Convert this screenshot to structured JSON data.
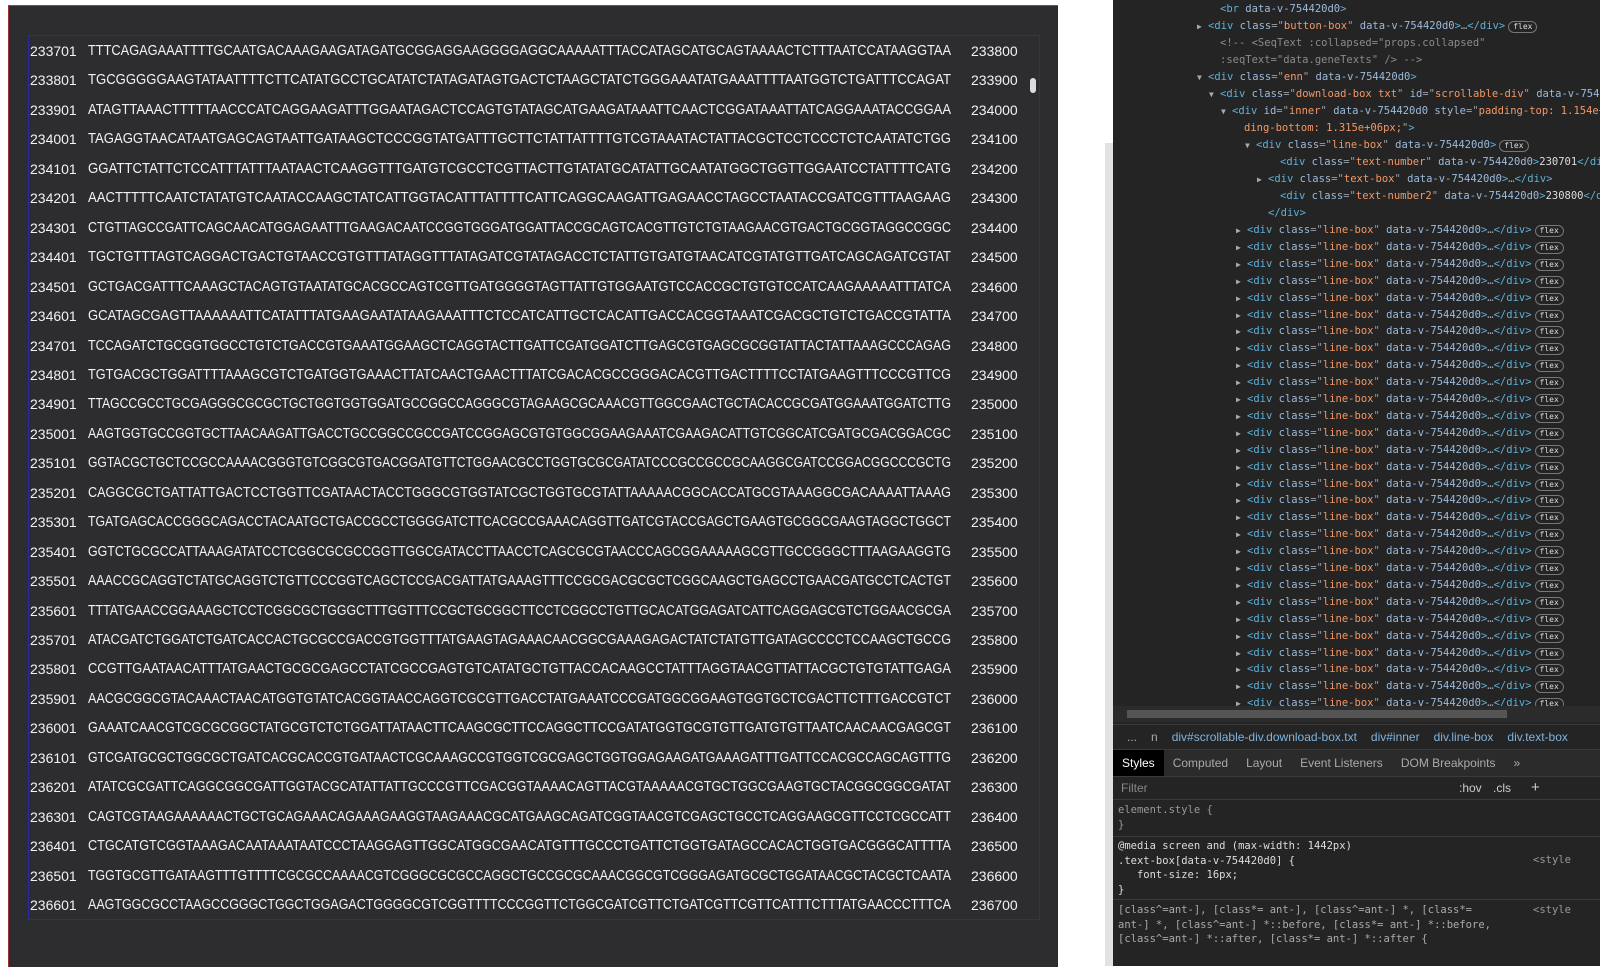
{
  "sequence_lines": [
    {
      "start": "233701",
      "seq": "TTTCAGAGAAATTTTGCAATGACAAAGAAGATAGATGCGGAGGAAGGGGAGGCAAAAATTTACCATAGCATGCAGTAAAACTCTTTAATCCATAAGGTAA",
      "end": "233800"
    },
    {
      "start": "233801",
      "seq": "TGCGGGGGAAGTATAATTTTCTTCATATGCCTGCATATCTATAGATAGTGACTCTAAGCTATCTGGGAAATATGAAATTTTAATGGTCTGATTTCCAGAT",
      "end": "233900"
    },
    {
      "start": "233901",
      "seq": "ATAGTTAAACTTTTTAACCCATCAGGAAGATTTGGAATAGACTCCAGTGTATAGCATGAAGATAAATTCAACTCGGATAAATTATCAGGAAATACCGGAA",
      "end": "234000"
    },
    {
      "start": "234001",
      "seq": "TAGAGGTAACATAATGAGCAGTAATTGATAAGCTCCCGGTATGATTTGCTTCTATTATTTTGTCGTAAATACTATTACGCTCCTCCCTCTCAATATCTGG",
      "end": "234100"
    },
    {
      "start": "234101",
      "seq": "GGATTCTATTCTCCATTTATTTAATAACTCAAGGTTTGATGTCGCCTCGTTACTTGTATATGCATATTGCAATATGGCTGGTTGGAATCCTATTTTCATG",
      "end": "234200"
    },
    {
      "start": "234201",
      "seq": "AACTTTTTCAATCTATATGTCAATACCAAGCTATCATTGGTACATTTATTTTCATTCAGGCAAGATTGAGAACCTAGCCTAATACCGATCGTTTAAGAAG",
      "end": "234300"
    },
    {
      "start": "234301",
      "seq": "CTGTTAGCCGATTCAGCAACATGGAGAATTTGAAGACAATCCGGTGGGATGGATTACCGCAGTCACGTTGTCTGTAAGAACGTGACTGCGGTAGGCCGGC",
      "end": "234400"
    },
    {
      "start": "234401",
      "seq": "TGCTGTTTAGTCAGGACTGACTGTAACCGTGTTTATAGGTTTATAGATCGTATAGACCTCTATTGTGATGTAACATCGTATGTTGATCAGCAGATCGTAT",
      "end": "234500"
    },
    {
      "start": "234501",
      "seq": "GCTGACGATTTCAAAGCTACAGTGTAATATGCACGCCAGTCGTTGATGGGGTAGTTATTGTGGAATGTCCACCGCTGTGTCCATCAAGAAAAATTTATCA",
      "end": "234600"
    },
    {
      "start": "234601",
      "seq": "GCATAGCGAGTTAAAAAATTCATATTTATGAAGAATATAAGAAATTTCTCCATCATTGCTCACATTGACCACGGTAAATCGACGCTGTCTGACCGTATTA",
      "end": "234700"
    },
    {
      "start": "234701",
      "seq": "TCCAGATCTGCGGTGGCCTGTCTGACCGTGAAATGGAAGCTCAGGTACTTGATTCGATGGATCTTGAGCGTGAGCGCGGTATTACTATTAAAGCCCAGAG",
      "end": "234800"
    },
    {
      "start": "234801",
      "seq": "TGTGACGCTGGATTTTAAAGCGTCTGATGGTGAAACTTATCAACTGAACTTTATCGACACGCCGGGACACGTTGACTTTTCCTATGAAGTTTCCCGTTCG",
      "end": "234900"
    },
    {
      "start": "234901",
      "seq": "TTAGCCGCCTGCGAGGGCGCGCTGCTGGTGGTGGATGCCGGCCAGGGCGTAGAAGCGCAAACGTTGGCGAACTGCTACACCGCGATGGAAATGGATCTTG",
      "end": "235000"
    },
    {
      "start": "235001",
      "seq": "AAGTGGTGCCGGTGCTTAACAAGATTGACCTGCCGGCCGCCGATCCGGAGCGTGTGGCGGAAGAAATCGAAGACATTGTCGGCATCGATGCGACGGACGC",
      "end": "235100"
    },
    {
      "start": "235101",
      "seq": "GGTACGCTGCTCCGCCAAAACGGGTGTCGGCGTGACGGATGTTCTGGAACGCCTGGTGCGCGATATCCCGCCGCCGCAAGGCGATCCGGACGGCCCGCTG",
      "end": "235200"
    },
    {
      "start": "235201",
      "seq": "CAGGCGCTGATTATTGACTCCTGGTTCGATAACTACCTGGGCGTGGTATCGCTGGTGCGTATTAAAAACGGCACCATGCGTAAAGGCGACAAAATTAAAG",
      "end": "235300"
    },
    {
      "start": "235301",
      "seq": "TGATGAGCACCGGGCAGACCTACAATGCTGACCGCCTGGGGATCTTCACGCCGAAACAGGTTGATCGTACCGAGCTGAAGTGCGGCGAAGTAGGCTGGCT",
      "end": "235400"
    },
    {
      "start": "235401",
      "seq": "GGTCTGCGCCATTAAAGATATCCTCGGCGCGCCGGTTGGCGATACCTTAACCTCAGCGCGTAACCCAGCGGAAAAAGCGTTGCCGGGCTTTAAGAAGGTG",
      "end": "235500"
    },
    {
      "start": "235501",
      "seq": "AAACCGCAGGTCTATGCAGGTCTGTTCCCGGTCAGCTCCGACGATTATGAAAGTTTCCGCGACGCGCTCGGCAAGCTGAGCCTGAACGATGCCTCACTGT",
      "end": "235600"
    },
    {
      "start": "235601",
      "seq": "TTTATGAACCGGAAAGCTCCTCGGCGCTGGGCTTTGGTTTCCGCTGCGGCTTCCTCGGCCTGTTGCACATGGAGATCATTCAGGAGCGTCTGGAACGCGA",
      "end": "235700"
    },
    {
      "start": "235701",
      "seq": "ATACGATCTGGATCTGATCACCACTGCGCCGACCGTGGTTTATGAAGTAGAAACAACGGCGAAAGAGACTATCTATGTTGATAGCCCCTCCAAGCTGCCG",
      "end": "235800"
    },
    {
      "start": "235801",
      "seq": "CCGTTGAATAACATTTATGAACTGCGCGAGCCTATCGCCGAGTGTCATATGCTGTTACCACAAGCCTATTTAGGTAACGTTATTACGCTGTGTATTGAGA",
      "end": "235900"
    },
    {
      "start": "235901",
      "seq": "AACGCGGCGTACAAACTAACATGGTGTATCACGGTAACCAGGTCGCGTTGACCTATGAAATCCCGATGGCGGAAGTGGTGCTCGACTTCTTTGACCGTCT",
      "end": "236000"
    },
    {
      "start": "236001",
      "seq": "GAAATCAACGTCGCGCGGCTATGCGTCTCTGGATTATAACTTCAAGCGCTTCCAGGCTTCCGATATGGTGCGTGTTGATGTGTTAATCAACAACGAGCGT",
      "end": "236100"
    },
    {
      "start": "236101",
      "seq": "GTCGATGCGCTGGCGCTGATCACGCACCGTGATAACTCGCAAAGCCGTGGTCGCGAGCTGGTGGAGAAGATGAAAGATTTGATTCCACGCCAGCAGTTTG",
      "end": "236200"
    },
    {
      "start": "236201",
      "seq": "ATATCGCGATTCAGGCGGCGATTGGTACGCATATTATTGCCCGTTCGACGGTAAAACAGTTACGTAAAAACGTGCTGGCGAAGTGCTACGGCGGCGATAT",
      "end": "236300"
    },
    {
      "start": "236301",
      "seq": "CAGTCGTAAGAAAAAACTGCTGCAGAAACAGAAAGAAGGTAAGAAACGCATGAAGCAGATCGGTAACGTCGAGCTGCCTCAGGAAGCGTTCCTCGCCATT",
      "end": "236400"
    },
    {
      "start": "236401",
      "seq": "CTGCATGTCGGTAAAGACAATAAATAATCCCTAAGGAGTTGGCATGGCGAACATGTTTGCCCTGATTCTGGTGATAGCCACACTGGTGACGGGCATTTTA",
      "end": "236500"
    },
    {
      "start": "236501",
      "seq": "TGGTGCGTTGATAAGTTTGTTTTCGCGCCAAAACGTCGGGCGCGCCAGGCTGCCGCGCAAACGGCGTCGGGAGATGCGCTGGATAACGCTACGCTCAATA",
      "end": "236600"
    },
    {
      "start": "236601",
      "seq": "AAGTGGCGCCTAAGCCGGGCTGGCTGGAGACTGGGGCGTCGGTTTTCCCGGTTCTGGCGATCGTTCTGATCGTTCGTTCATTTCTTTATGAACCCTTTCA",
      "end": "236700"
    }
  ],
  "devtools": {
    "elements": [
      {
        "indent": 6,
        "tri": "",
        "html": "<span class='tag'>&lt;br</span> <span class='attr'>data-v-754420d0</span><span class='tag'>&gt;</span>"
      },
      {
        "indent": 5,
        "tri": "▶",
        "html": "<span class='tag'>&lt;div</span> <span class='attr'>class</span>=\"<span class='val'>button-box</span>\" <span class='attr'>data-v-754420d0</span><span class='tag'>&gt;</span>…<span class='tag'>&lt;/div&gt;</span><span class='badge'>flex</span>"
      },
      {
        "indent": 6,
        "tri": "",
        "html": "<span class='cm'>&lt;!-- &lt;SeqText :collapsed=\"props.collapsed\"</span>"
      },
      {
        "indent": 6,
        "tri": "",
        "html": "<span class='cm'>:seqText=\"data.geneTexts\" /&gt; --&gt;</span>"
      },
      {
        "indent": 5,
        "tri": "▼",
        "html": "<span class='tag'>&lt;div</span> <span class='attr'>class</span>=\"<span class='val'>enn</span>\" <span class='attr'>data-v-754420d0</span><span class='tag'>&gt;</span>"
      },
      {
        "indent": 6,
        "tri": "▼",
        "html": "<span class='tag'>&lt;div</span> <span class='attr'>class</span>=\"<span class='val'>download-box txt</span>\" <span class='attr'>id</span>=\"<span class='val'>scrollable-div</span>\" <span class='attr'>data-v-754420d0</span>"
      },
      {
        "indent": 7,
        "tri": "▼",
        "html": "<span class='tag'>&lt;div</span> <span class='attr'>id</span>=\"<span class='val'>inner</span>\" <span class='attr'>data-v-754420d0</span> <span class='attr'>style</span>=\"<span class='val'>padding-top: 1.154e+06px; pad</span>"
      },
      {
        "indent": 8,
        "tri": "",
        "html": "<span class='val'>ding-bottom: 1.315e+06px;</span>\"<span class='tag'>&gt;</span>"
      },
      {
        "indent": 9,
        "tri": "▼",
        "html": "<span class='tag'>&lt;div</span> <span class='attr'>class</span>=\"<span class='val'>line-box</span>\" <span class='attr'>data-v-754420d0</span><span class='tag'>&gt;</span><span class='badge'>flex</span>"
      },
      {
        "indent": 11,
        "tri": "",
        "html": "<span class='tag'>&lt;div</span> <span class='attr'>class</span>=\"<span class='val'>text-number</span>\" <span class='attr'>data-v-754420d0</span><span class='tag'>&gt;</span><span style='color:#ddd'>230701</span><span class='tag'>&lt;/div&gt;</span>"
      },
      {
        "indent": 10,
        "tri": "▶",
        "html": "<span class='tag'>&lt;div</span> <span class='attr'>class</span>=\"<span class='val'>text-box</span>\" <span class='attr'>data-v-754420d0</span><span class='tag'>&gt;</span>…<span class='tag'>&lt;/div&gt;</span>"
      },
      {
        "indent": 11,
        "tri": "",
        "html": "<span class='tag'>&lt;div</span> <span class='attr'>class</span>=\"<span class='val'>text-number2</span>\" <span class='attr'>data-v-754420d0</span><span class='tag'>&gt;</span><span style='color:#ddd'>230800</span><span class='tag'>&lt;/div&gt;</span>"
      },
      {
        "indent": 10,
        "tri": "",
        "html": "<span class='tag'>&lt;/div&gt;</span>"
      }
    ],
    "collapsed_line_box": "<span class='tag'>&lt;div</span> <span class='attr'>class</span>=\"<span class='val'>line-box</span>\" <span class='attr'>data-v-754420d0</span><span class='tag'>&gt;</span>…<span class='tag'>&lt;/div&gt;</span><span class='badge'>flex</span>",
    "collapsed_line_box_count": 29,
    "breadcrumbs": [
      "...",
      "n",
      "div#scrollable-div.download-box.txt",
      "div#inner",
      "div.line-box",
      "div.text-box"
    ],
    "tabs": [
      "Styles",
      "Computed",
      "Layout",
      "Event Listeners",
      "DOM Breakpoints",
      "»"
    ],
    "active_tab": "Styles",
    "filter_placeholder": "Filter",
    "filter_tools": [
      ":hov",
      ".cls",
      "+"
    ],
    "rules": {
      "element_style": "element.style {\n}",
      "media_rule": "@media screen and (max-width: 1442px)\n.text-box[data-v-754420d0] {\n   font-size: 16px;\n}",
      "ant_rule": "[class^=ant-], [class*= ant-], [class^=ant-] *, [class*=\nant-] *, [class^=ant-] *::before, [class*= ant-] *::before,\n[class^=ant-] *::after, [class*= ant-] *::after {",
      "source": "<style"
    }
  }
}
